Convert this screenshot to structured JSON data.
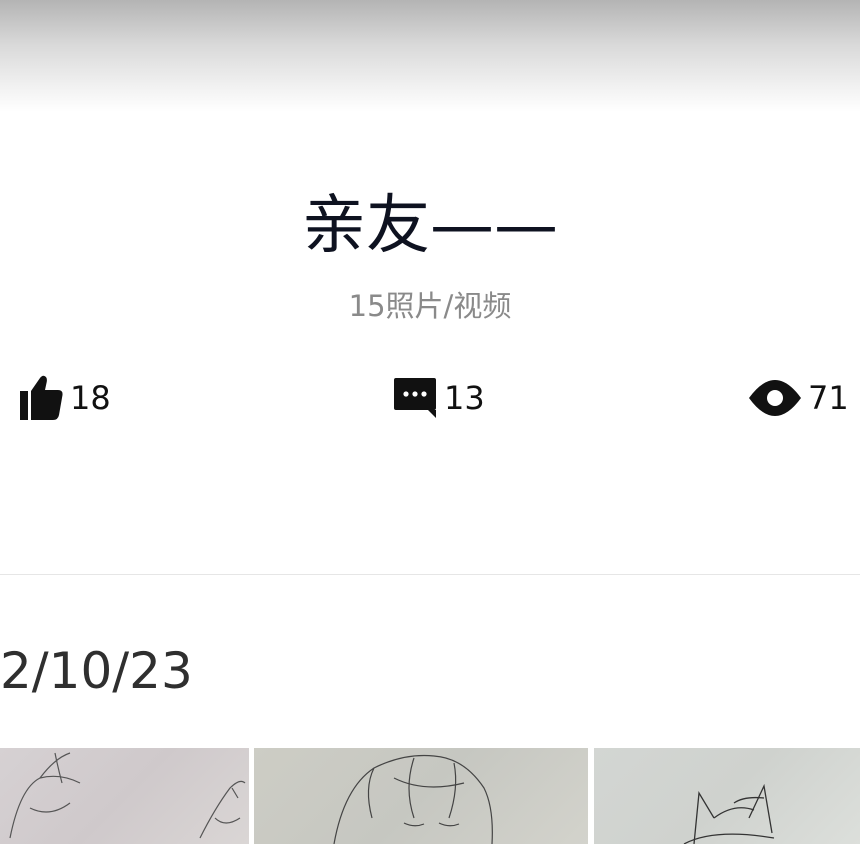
{
  "album": {
    "title": "亲友——",
    "subtitle": "15照片/视频"
  },
  "stats": {
    "likes": {
      "icon": "thumbs-up-icon",
      "count": "18"
    },
    "comments": {
      "icon": "comment-icon",
      "count": "13"
    },
    "views": {
      "icon": "eye-icon",
      "count": "71"
    }
  },
  "section": {
    "date": "2/10/23"
  },
  "colors": {
    "title": "#0e1220",
    "subtitle": "#8a8a8a",
    "divider": "#e6e6e6"
  }
}
